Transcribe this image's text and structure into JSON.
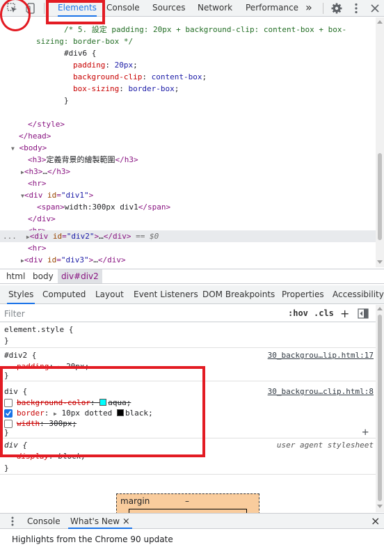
{
  "toolbar": {
    "tabs": [
      "Elements",
      "Console",
      "Sources",
      "Network",
      "Performance"
    ],
    "active_tab": "Elements",
    "more_label": "»",
    "icons": [
      "inspect-element-icon",
      "device-toolbar-icon",
      "gear-icon",
      "kebab-menu-icon",
      "close-icon"
    ]
  },
  "dom_tree": {
    "comment_line1": "/* 5. 設定 padding: 20px + background-clip: content-box + box-",
    "comment_line2": "sizing: border-box */",
    "selector": "#div6 {",
    "prop1_name": "padding",
    "prop1_value": "20px",
    "prop2_name": "background-clip",
    "prop2_value": "content-box",
    "prop3_name": "box-sizing",
    "prop3_value": "border-box",
    "close_brace": "}",
    "style_close": "</style>",
    "head_close": "</head>",
    "body_open": "<body>",
    "h3_text": "定義背景的繪製範圍",
    "h3_collapsed": "…",
    "hr": "<hr>",
    "div1_id": "div1",
    "span_text": "width:300px div1",
    "div_close": "</div>",
    "div2_id": "div2",
    "div3_id": "div3",
    "ellipsis": "…",
    "selected_marker": "== $0",
    "dots": "..."
  },
  "breadcrumbs": [
    "html",
    "body",
    "div#div2"
  ],
  "styles_tabs": [
    "Styles",
    "Computed",
    "Layout",
    "Event Listeners",
    "DOM Breakpoints",
    "Properties",
    "Accessibility"
  ],
  "filter": {
    "placeholder": "Filter",
    "hov": ":hov",
    "cls": ".cls",
    "plus": "+"
  },
  "rules": {
    "element_style": "element.style {",
    "close": "}",
    "div2_selector": "#div2 {",
    "div2_source": "30_backgrou…lip.html:17",
    "div2_prop": "padding",
    "div2_value": "20px",
    "div_selector": "div {",
    "div_source": "30_backgrou…clip.html:8",
    "bg_prop": "background-color",
    "bg_value": "aqua",
    "bg_color": "#00ffff",
    "border_prop": "border",
    "border_value_a": "10px dotted",
    "border_value_b": "black",
    "border_color": "#000000",
    "width_prop": "width",
    "width_value": "300px",
    "add_plus": "+",
    "ua_selector": "div {",
    "ua_source": "user agent stylesheet",
    "ua_prop": "display",
    "ua_value": "block"
  },
  "box_model": {
    "label": "margin",
    "value": "–"
  },
  "drawer": {
    "tabs": [
      "Console",
      "What's New"
    ],
    "active_tab": "What's New",
    "close_tab_label": "×",
    "content": "Highlights from the Chrome 90 update",
    "close_label": "×"
  },
  "colors": {
    "accent": "#1a73e8",
    "annotation": "#e31b23",
    "tag": "#881280",
    "attr_name": "#994500",
    "attr_value": "#1a1aa6",
    "css_prop": "#c80000"
  }
}
